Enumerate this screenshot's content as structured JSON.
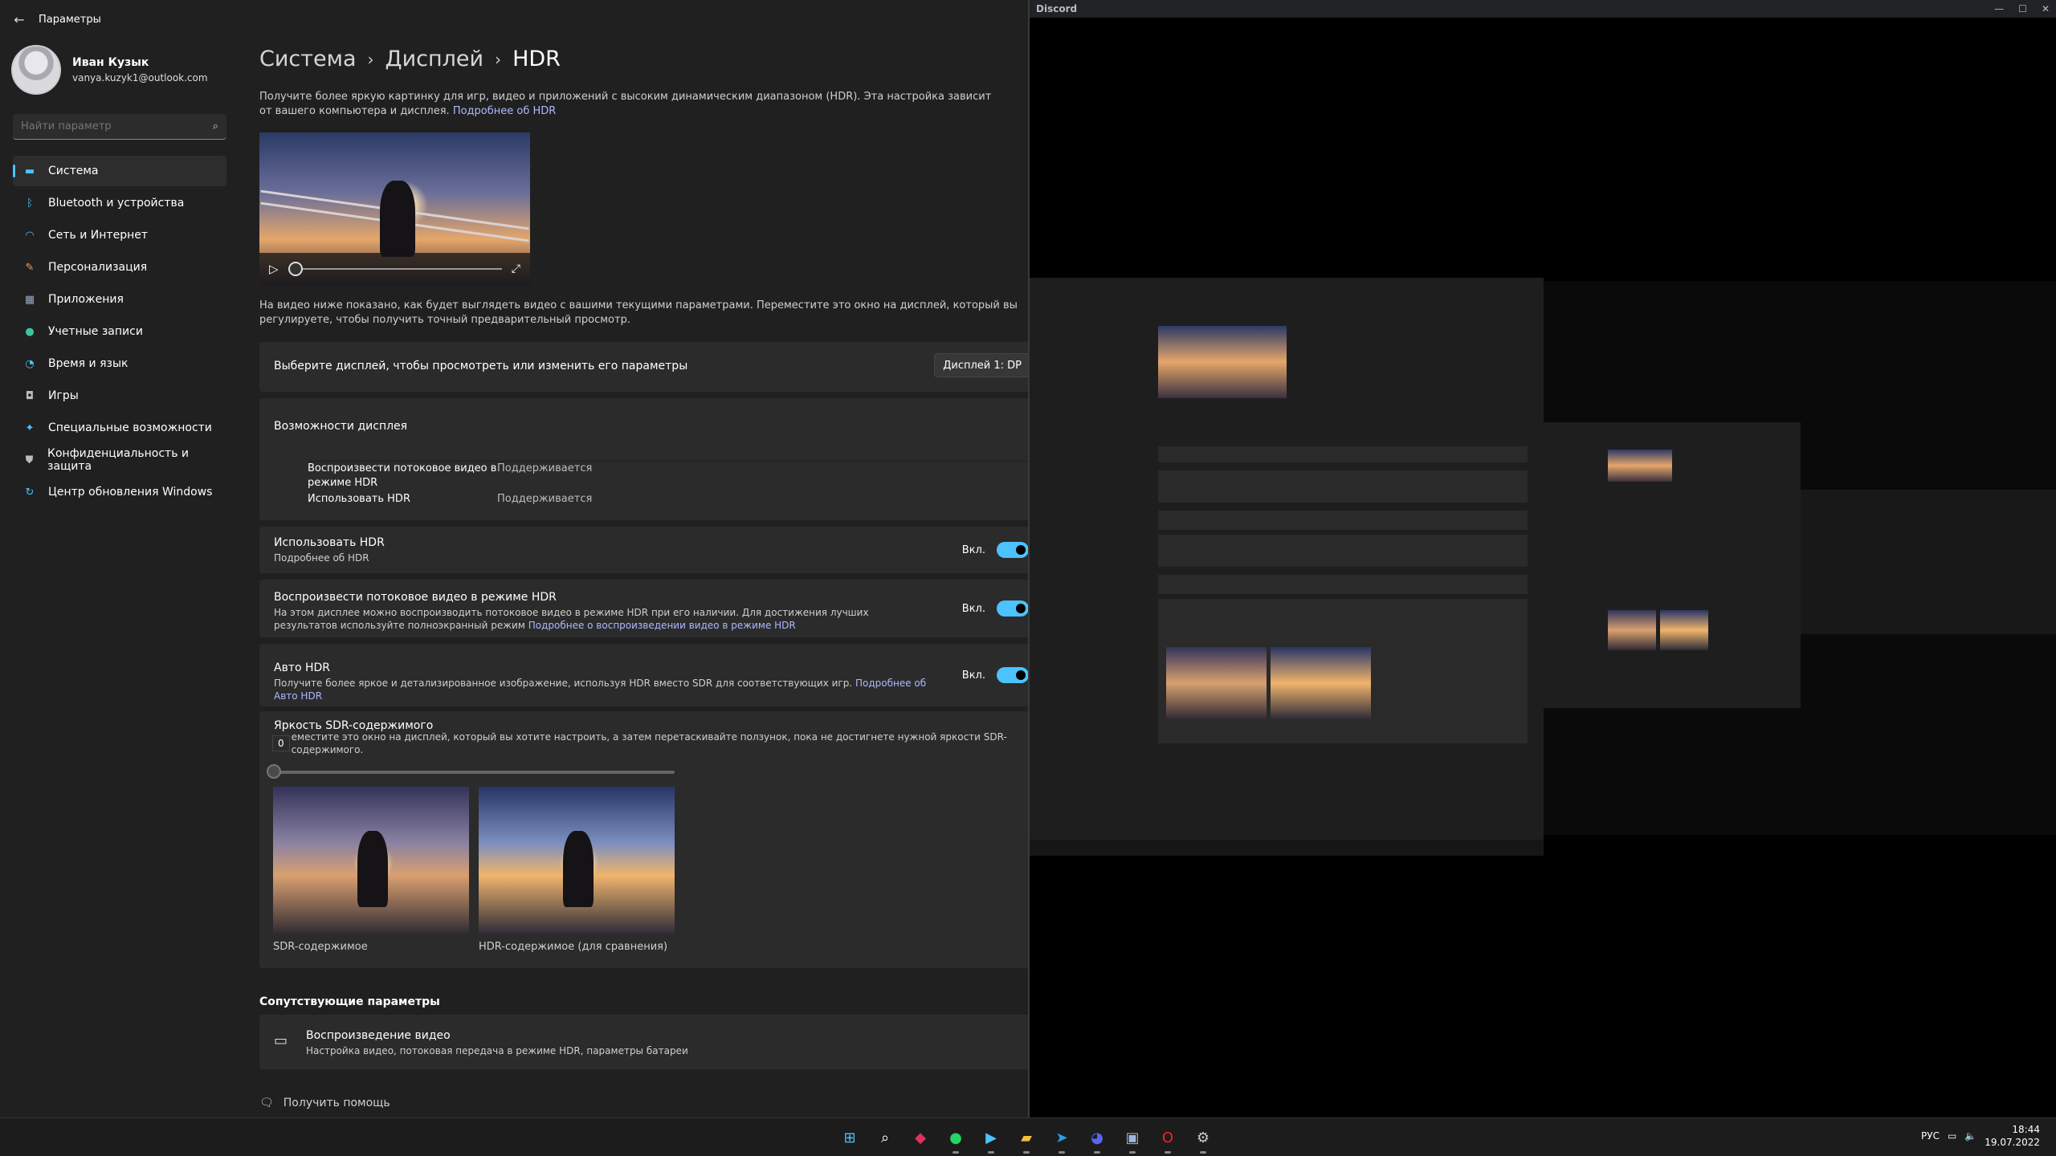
{
  "settings": {
    "app_title": "Параметры",
    "user": {
      "name": "Иван Кузык",
      "email": "vanya.kuzyk1@outlook.com"
    },
    "search_placeholder": "Найти параметр",
    "nav": [
      {
        "label": "Система",
        "icon": "display-icon",
        "color": "#4cc2ff",
        "active": true
      },
      {
        "label": "Bluetooth и устройства",
        "icon": "bluetooth-icon",
        "color": "#4cc2ff"
      },
      {
        "label": "Сеть и Интернет",
        "icon": "wifi-icon",
        "color": "#4cc2ff"
      },
      {
        "label": "Персонализация",
        "icon": "brush-icon",
        "color": "#e8a060"
      },
      {
        "label": "Приложения",
        "icon": "apps-icon",
        "color": "#9aa8c8"
      },
      {
        "label": "Учетные записи",
        "icon": "person-icon",
        "color": "#3cc4a0"
      },
      {
        "label": "Время и язык",
        "icon": "globe-clock-icon",
        "color": "#4cc2ff"
      },
      {
        "label": "Игры",
        "icon": "gamepad-icon",
        "color": "#bbbbbb"
      },
      {
        "label": "Специальные возможности",
        "icon": "accessibility-icon",
        "color": "#4cc2ff"
      },
      {
        "label": "Конфиденциальность и защита",
        "icon": "shield-icon",
        "color": "#bbbbbb"
      },
      {
        "label": "Центр обновления Windows",
        "icon": "update-icon",
        "color": "#4cc2ff"
      }
    ],
    "breadcrumb": [
      "Система",
      "Дисплей",
      "HDR"
    ],
    "intro_text": "Получите более яркую картинку для игр, видео и приложений с высоким динамическим диапазоном (HDR). Эта настройка зависит от вашего компьютера и дисплея.",
    "intro_link": "Подробнее об HDR",
    "video_note": "На видео ниже показано, как будет выглядеть видео с вашими текущими параметрами. Переместите это окно на дисплей, который вы регулируете, чтобы получить точный предварительный просмотр.",
    "display_select": {
      "label": "Выберите дисплей, чтобы просмотреть или изменить его параметры",
      "value": "Дисплей 1: DP"
    },
    "capabilities": {
      "title": "Возможности дисплея",
      "rows": [
        {
          "key": "Воспроизвести потоковое видео в режиме HDR",
          "value": "Поддерживается"
        },
        {
          "key": "Использовать HDR",
          "value": "Поддерживается"
        }
      ]
    },
    "use_hdr": {
      "title": "Использовать HDR",
      "link": "Подробнее об HDR",
      "state": "Вкл."
    },
    "stream_hdr": {
      "title": "Воспроизвести потоковое видео в режиме HDR",
      "desc": "На этом дисплее можно воспроизводить потоковое видео в режиме HDR при его наличии. Для достижения лучших результатов используйте полноэкранный режим",
      "link": "Подробнее о воспроизведении видео в режиме HDR",
      "state": "Вкл."
    },
    "auto_hdr": {
      "title": "Авто HDR",
      "desc": "Получите более яркое и детализированное изображение, используя HDR вместо SDR для соответствующих игр.",
      "link": "Подробнее об Авто HDR",
      "state": "Вкл."
    },
    "sdr_brightness": {
      "title": "Яркость SDR-содержимого",
      "desc": "еместите это окно на дисплей, который вы хотите настроить, а затем перетаскивайте ползунок, пока не достигнете нужной яркости SDR-содержимого.",
      "tooltip": "0",
      "level": 0
    },
    "thumb_sdr_caption": "SDR-содержимое",
    "thumb_hdr_caption": "HDR-содержимое (для сравнения)",
    "related_title": "Сопутствующие параметры",
    "playback": {
      "title": "Воспроизведение видео",
      "desc": "Настройка видео, потоковая передача в режиме HDR, параметры батареи"
    },
    "help": "Получить помощь"
  },
  "discord": {
    "title": "Discord"
  },
  "taskbar": {
    "apps": [
      {
        "name": "start-icon",
        "glyph": "⊞",
        "color": "#4cc2ff"
      },
      {
        "name": "search-icon",
        "glyph": "⌕",
        "color": "#ffffff"
      },
      {
        "name": "app-red-icon",
        "glyph": "◆",
        "color": "#e03060"
      },
      {
        "name": "whatsapp-icon",
        "glyph": "●",
        "color": "#25d366"
      },
      {
        "name": "play-store-icon",
        "glyph": "▶",
        "color": "#4cc2ff"
      },
      {
        "name": "explorer-icon",
        "glyph": "▰",
        "color": "#f0c040"
      },
      {
        "name": "telegram-icon",
        "glyph": "➤",
        "color": "#2aa0e0"
      },
      {
        "name": "discord-icon",
        "glyph": "◕",
        "color": "#5865f2"
      },
      {
        "name": "photos-icon",
        "glyph": "▣",
        "color": "#9ab8e0"
      },
      {
        "name": "opera-icon",
        "glyph": "O",
        "color": "#ff1b2d"
      },
      {
        "name": "settings-icon",
        "glyph": "⚙",
        "color": "#cccccc"
      }
    ],
    "lang": "РУС",
    "time": "18:44",
    "date": "19.07.2022"
  }
}
